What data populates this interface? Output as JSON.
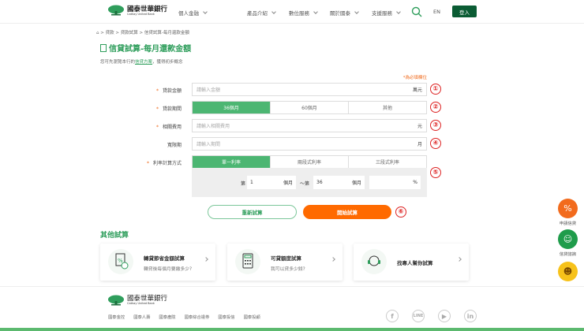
{
  "header": {
    "brand_zh": "國泰世華銀行",
    "brand_en": "Cathay United Bank",
    "personal": "個人金融",
    "nav": [
      "產品介紹",
      "數位服務",
      "關於國泰",
      "支援服務"
    ],
    "lang": "EN",
    "login": "登入"
  },
  "breadcrumb": [
    "貸款",
    "貸款試算",
    "信貸試算-每月還款金額"
  ],
  "page": {
    "title": "信貸試算-每月還款金額",
    "sub_prefix": "您可先瀏覽本行的",
    "sub_link": "信貸方案",
    "sub_suffix": "，獲得初步概念",
    "required_note": "*為必填欄位"
  },
  "form": {
    "amount": {
      "label": "貸款金額",
      "placeholder": "請輸入金額",
      "unit": "萬元",
      "step": "①"
    },
    "term": {
      "label": "貸款期間",
      "options": [
        "36個月",
        "60個月",
        "其他"
      ],
      "selected": "36個月",
      "step": "②"
    },
    "fee": {
      "label": "相關費用",
      "placeholder": "請輸入相關費用",
      "unit": "元",
      "step": "③"
    },
    "grace": {
      "label": "寬限期",
      "placeholder": "請輸入期間",
      "unit": "月",
      "step": "④"
    },
    "rate": {
      "label": "利率計算方式",
      "options": [
        "單一利率",
        "兩段式利率",
        "三段式利率"
      ],
      "selected": "單一利率",
      "step": "⑤",
      "from_prefix": "第",
      "from_value": "1",
      "from_unit": "個月",
      "sep": "～第",
      "to_value": "36",
      "to_unit": "個月",
      "pct_unit": "%"
    }
  },
  "actions": {
    "reset": "重新試算",
    "start": "開始試算",
    "step": "⑥"
  },
  "other": {
    "title": "其他試算",
    "cards": [
      {
        "title": "轉貸節省金額試算",
        "sub": "轉貸後每個月要繳多少?"
      },
      {
        "title": "可貸額度試算",
        "sub": "我可以貸多少錢?"
      },
      {
        "title": "找專人幫你試算",
        "sub": ""
      }
    ]
  },
  "footer": {
    "brand_zh": "國泰世華銀行",
    "brand_en": "Cathay United Bank",
    "links": [
      "國泰金控",
      "國泰人壽",
      "國泰產險",
      "國泰綜合證券",
      "國泰投信",
      "國泰投顧"
    ],
    "social": [
      "facebook",
      "line",
      "youtube",
      "linkedin"
    ]
  },
  "floats": [
    {
      "label": "申請信貸"
    },
    {
      "label": "信貸諮詢"
    }
  ],
  "colors": {
    "green": "#4cb672",
    "dark_green": "#0b5c34",
    "orange": "#ff6a00"
  }
}
